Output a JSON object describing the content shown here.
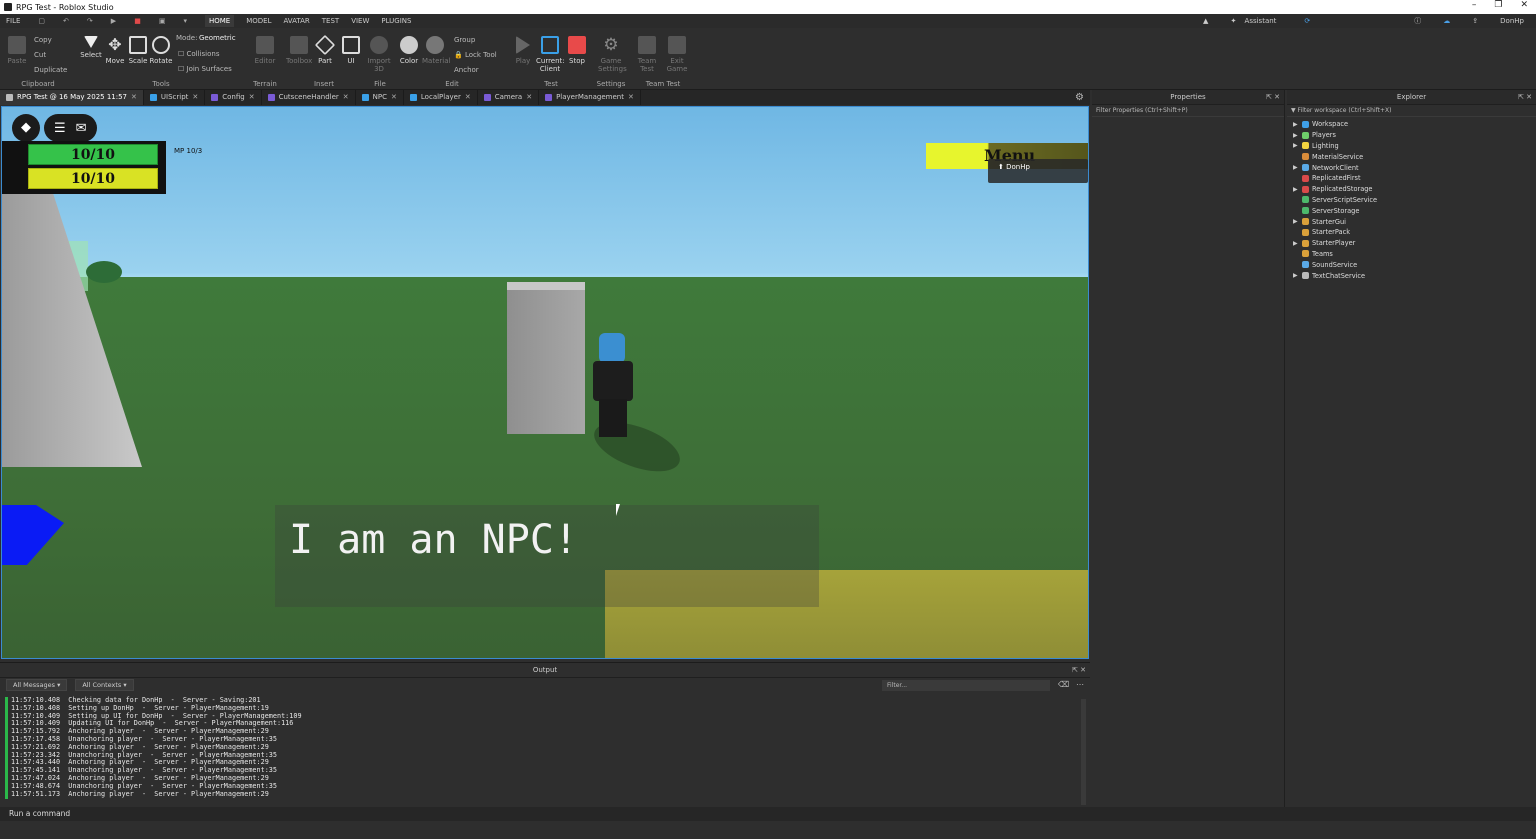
{
  "window": {
    "title": "RPG Test - Roblox Studio",
    "controls": [
      "–",
      "❐",
      "✕"
    ]
  },
  "menubar": {
    "file": "FILE",
    "tabs": [
      "HOME",
      "MODEL",
      "AVATAR",
      "TEST",
      "VIEW",
      "PLUGINS"
    ],
    "active": "HOME",
    "assistant": "Assistant",
    "user": "DonHp"
  },
  "ribbon": {
    "clipboard": {
      "label": "Clipboard",
      "paste": "Paste",
      "copy": "Copy",
      "cut": "Cut",
      "duplicate": "Duplicate"
    },
    "tools": {
      "label": "Tools",
      "select": "Select",
      "move": "Move",
      "scale": "Scale",
      "rotate": "Rotate",
      "mode_label": "Mode:",
      "mode_value": "Geometric",
      "collisions": "Collisions",
      "join_surfaces": "Join Surfaces"
    },
    "terrain": {
      "label": "Terrain",
      "editor": "Editor"
    },
    "insert": {
      "label": "Insert",
      "toolbox": "Toolbox",
      "part": "Part",
      "ui": "UI"
    },
    "file": {
      "label": "File",
      "import3d": "Import 3D"
    },
    "edit": {
      "label": "Edit",
      "color": "Color",
      "material": "Material",
      "group": "Group",
      "lock_tool": "Lock Tool",
      "anchor": "Anchor"
    },
    "test": {
      "label": "Test",
      "play": "Play",
      "current_client": "Current: Client",
      "stop": "Stop"
    },
    "settings": {
      "label": "Settings",
      "game_settings": "Game Settings"
    },
    "team_test": {
      "label": "Team Test",
      "team_test": "Team Test",
      "exit_game": "Exit Game"
    }
  },
  "tabs": [
    {
      "label": "RPG Test @ 16 May 2025 11:57",
      "active": true
    },
    {
      "label": "UIScript"
    },
    {
      "label": "Config"
    },
    {
      "label": "CutsceneHandler"
    },
    {
      "label": "NPC"
    },
    {
      "label": "LocalPlayer"
    },
    {
      "label": "Camera"
    },
    {
      "label": "PlayerManagement"
    }
  ],
  "game": {
    "hp": "10/10",
    "mp": "10/10",
    "mp_label": "MP 10/3",
    "menu": "Menu",
    "player_name": "DonHp",
    "dialog": "I am an NPC!"
  },
  "properties": {
    "title": "Properties",
    "filter": "Filter Properties (Ctrl+Shift+P)"
  },
  "explorer": {
    "title": "Explorer",
    "filter": "Filter workspace (Ctrl+Shift+X)",
    "items": [
      {
        "name": "Workspace",
        "expandable": true,
        "color": "#3fa0e8"
      },
      {
        "name": "Players",
        "expandable": true,
        "color": "#6fcf6a"
      },
      {
        "name": "Lighting",
        "expandable": true,
        "color": "#f2d440"
      },
      {
        "name": "MaterialService",
        "expandable": false,
        "color": "#d98c3a"
      },
      {
        "name": "NetworkClient",
        "expandable": true,
        "color": "#5aa9e6"
      },
      {
        "name": "ReplicatedFirst",
        "expandable": false,
        "color": "#d94a4a"
      },
      {
        "name": "ReplicatedStorage",
        "expandable": true,
        "color": "#d94a4a"
      },
      {
        "name": "ServerScriptService",
        "expandable": false,
        "color": "#4db86b"
      },
      {
        "name": "ServerStorage",
        "expandable": false,
        "color": "#4db86b"
      },
      {
        "name": "StarterGui",
        "expandable": true,
        "color": "#d9a03a"
      },
      {
        "name": "StarterPack",
        "expandable": false,
        "color": "#d9a03a"
      },
      {
        "name": "StarterPlayer",
        "expandable": true,
        "color": "#d9a03a"
      },
      {
        "name": "Teams",
        "expandable": false,
        "color": "#d9a03a"
      },
      {
        "name": "SoundService",
        "expandable": false,
        "color": "#5aa9e6"
      },
      {
        "name": "TextChatService",
        "expandable": true,
        "color": "#bbbbbb"
      }
    ]
  },
  "output": {
    "title": "Output",
    "messages_filter": "All Messages",
    "contexts_filter": "All Contexts",
    "filter_placeholder": "Filter...",
    "logs": [
      "11:57:10.408  Checking data for DonHp  -  Server - Saving:201",
      "11:57:10.408  Setting up DonHp  -  Server - PlayerManagement:19",
      "11:57:10.409  Setting up UI for DonHp  -  Server - PlayerManagement:109",
      "11:57:10.409  Updating UI for DonHp  -  Server - PlayerManagement:116",
      "11:57:15.792  Anchoring player  -  Server - PlayerManagement:29",
      "11:57:17.458  Unanchoring player  -  Server - PlayerManagement:35",
      "11:57:21.692  Anchoring player  -  Server - PlayerManagement:29",
      "11:57:23.342  Unanchoring player  -  Server - PlayerManagement:35",
      "11:57:43.440  Anchoring player  -  Server - PlayerManagement:29",
      "11:57:45.141  Unanchoring player  -  Server - PlayerManagement:35",
      "11:57:47.024  Anchoring player  -  Server - PlayerManagement:29",
      "11:57:48.674  Unanchoring player  -  Server - PlayerManagement:35",
      "11:57:51.173  Anchoring player  -  Server - PlayerManagement:29"
    ]
  },
  "command_bar": {
    "placeholder": "Run a command"
  }
}
